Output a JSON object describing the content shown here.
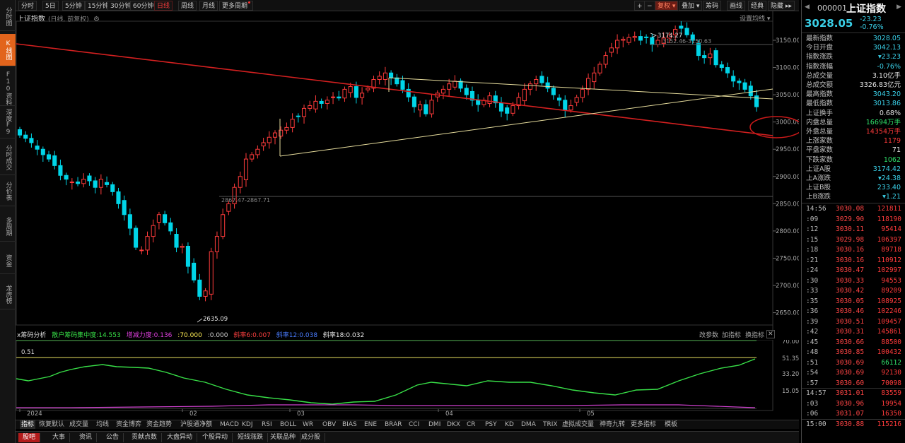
{
  "left_nav": [
    "分时图",
    "K线图",
    "F10资料",
    "深度F9",
    "分时成交",
    "分价表",
    "多周期",
    "资金",
    "龙虎榜"
  ],
  "toolbar": {
    "periods": [
      "分时",
      "5日",
      "5分钟",
      "15分钟",
      "30分钟",
      "60分钟",
      "日线",
      "周线",
      "月线",
      "更多周期"
    ],
    "selected_period": "日线",
    "right_tools": [
      "+",
      "−",
      "复权",
      "叠加",
      "筹码",
      "画线",
      "经典",
      "隐藏"
    ],
    "fuquan_label": "复权",
    "hide_label": "隐藏 ▸▸"
  },
  "chart": {
    "title": "上证指数",
    "subtitle": "(日线, 前复权)",
    "settings_label": "设置均线",
    "price_axis": [
      "3150.00",
      "3100.00",
      "3050.00",
      "3000.00",
      "2950.00",
      "2900.00",
      "2850.00",
      "2800.00",
      "2750.00",
      "2700.00",
      "2650.00"
    ],
    "annotations": {
      "high": "3174.27",
      "high_range": "3152.46-3150.63",
      "low": "2635.09",
      "mid": "2867.47-2867.71"
    },
    "ylim": [
      2630,
      3185
    ],
    "colors": {
      "up": "#ff3b3b",
      "down": "#00d5e8",
      "trend": "#d42020",
      "support": "#e6dc9c",
      "mark": "#cc1a1a"
    }
  },
  "indicator": {
    "name": "x筹码分析",
    "items": [
      {
        "label": "散户筹码集中度:14.553",
        "color": "#38e048"
      },
      {
        "label": "增减力度:0.136",
        "color": "#e040e0"
      },
      {
        "label": ":70.000",
        "color": "#ffee55"
      },
      {
        "label": ":0.000",
        "color": "#d0d0d0"
      },
      {
        "label": "斜率6:0.007",
        "color": "#ff4040"
      },
      {
        "label": "斜率12:0.038",
        "color": "#4a7cff"
      },
      {
        "label": "斜率18:0.032",
        "color": "#e8e8e8"
      }
    ],
    "tools": [
      "改参数",
      "加指标",
      "换指标"
    ],
    "axis": [
      "70.00",
      "51.35",
      "33.20",
      "15.05"
    ],
    "level_label": "0.51",
    "x_labels": [
      "2024",
      "02",
      "03",
      "04",
      "05"
    ]
  },
  "ind_tabs": [
    "指标",
    "恢复默认",
    "成交量",
    "均线",
    "资金博弈",
    "资金趋势",
    "沪股通净额",
    "MACD",
    "KDJ",
    "RSI",
    "BOLL",
    "WR",
    "OBV",
    "BIAS",
    "ENE",
    "BRAR",
    "CCI",
    "DMI",
    "DKX",
    "CR",
    "PSY",
    "KD",
    "DMA",
    "TRIX",
    "虚拟成交量",
    "神奇九转",
    "更多指标",
    "模板"
  ],
  "status_tabs": [
    "股吧",
    "大事",
    "资讯",
    "公告",
    "贡献点数",
    "大盘异动",
    "个股异动",
    "短线涨跌",
    "关联品种",
    "成分股"
  ],
  "quote": {
    "code": "000001",
    "name": "上证指数",
    "price": "3028.05",
    "change": "-23.23",
    "change_pct": "-0.76%",
    "rows": [
      {
        "k": "最新指数",
        "v": "3028.05",
        "c": "cyan"
      },
      {
        "k": "今日开盘",
        "v": "3042.13",
        "c": "cyan"
      },
      {
        "k": "指数涨跌",
        "v": "▾23.23",
        "c": "cyan"
      },
      {
        "k": "指数涨幅",
        "v": "-0.76%",
        "c": "cyan"
      },
      {
        "k": "总成交量",
        "v": "3.10亿手",
        "c": "white"
      },
      {
        "k": "总成交额",
        "v": "3326.83亿元",
        "c": "white"
      },
      {
        "k": "最高指数",
        "v": "3043.20",
        "c": "cyan"
      },
      {
        "k": "最低指数",
        "v": "3013.86",
        "c": "cyan"
      },
      {
        "k": "上证换手",
        "v": "0.68%",
        "c": "white"
      },
      {
        "k": "内盘总量",
        "v": "16694万手",
        "c": "green"
      },
      {
        "k": "外盘总量",
        "v": "14354万手",
        "c": "red"
      },
      {
        "k": "上涨家数",
        "v": "1179",
        "c": "red"
      },
      {
        "k": "平盘家数",
        "v": "71",
        "c": "white"
      },
      {
        "k": "下跌家数",
        "v": "1062",
        "c": "green"
      },
      {
        "k": "上证A股",
        "v": "3174.42",
        "c": "cyan"
      },
      {
        "k": "上A涨跌",
        "v": "▾24.38",
        "c": "cyan"
      },
      {
        "k": "上证B股",
        "v": "233.40",
        "c": "cyan"
      },
      {
        "k": "上B涨跌",
        "v": "▾1.21",
        "c": "cyan"
      }
    ],
    "ticks": [
      {
        "t": "14:56",
        "p": "3030.08",
        "q": "121811",
        "c": "red"
      },
      {
        "t": ":09",
        "p": "3029.90",
        "q": "118190",
        "c": "red"
      },
      {
        "t": ":12",
        "p": "3030.11",
        "q": "95414",
        "c": "red"
      },
      {
        "t": ":15",
        "p": "3029.98",
        "q": "106397",
        "c": "red"
      },
      {
        "t": ":18",
        "p": "3030.16",
        "q": "89718",
        "c": "red"
      },
      {
        "t": ":21",
        "p": "3030.16",
        "q": "110912",
        "c": "red"
      },
      {
        "t": ":24",
        "p": "3030.47",
        "q": "102997",
        "c": "red"
      },
      {
        "t": ":30",
        "p": "3030.33",
        "q": "94553",
        "c": "red"
      },
      {
        "t": ":33",
        "p": "3030.42",
        "q": "89209",
        "c": "red"
      },
      {
        "t": ":35",
        "p": "3030.05",
        "q": "108925",
        "c": "red"
      },
      {
        "t": ":36",
        "p": "3030.46",
        "q": "102246",
        "c": "red"
      },
      {
        "t": ":39",
        "p": "3030.51",
        "q": "109457",
        "c": "red"
      },
      {
        "t": ":42",
        "p": "3030.31",
        "q": "145861",
        "c": "red"
      },
      {
        "t": ":45",
        "p": "3030.66",
        "q": "88500",
        "c": "red"
      },
      {
        "t": ":48",
        "p": "3030.85",
        "q": "100432",
        "c": "red"
      },
      {
        "t": ":51",
        "p": "3030.69",
        "q": "66112",
        "c": "green"
      },
      {
        "t": ":54",
        "p": "3030.69",
        "q": "92130",
        "c": "red"
      },
      {
        "t": ":57",
        "p": "3030.60",
        "q": "70098",
        "c": "red"
      },
      {
        "t": "14:57",
        "p": "3031.01",
        "q": "83559",
        "c": "red"
      },
      {
        "t": ":03",
        "p": "3030.96",
        "q": "19954",
        "c": "red"
      },
      {
        "t": ":06",
        "p": "3031.07",
        "q": "16350",
        "c": "red"
      },
      {
        "t": "15:00",
        "p": "3030.88",
        "q": "115216",
        "c": "red"
      }
    ]
  }
}
